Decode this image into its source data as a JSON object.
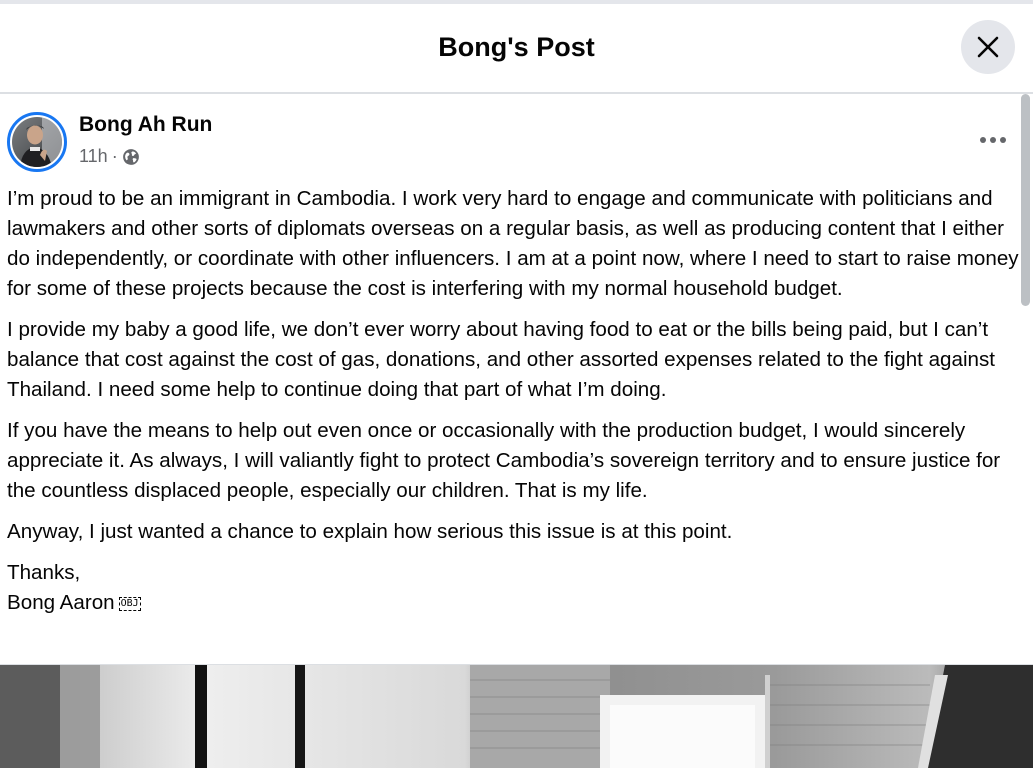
{
  "dialog": {
    "title": "Bong's Post",
    "close_icon": "close-icon"
  },
  "post": {
    "author": "Bong Ah Run",
    "time": "11h",
    "separator": "·",
    "audience_icon": "globe-icon",
    "more_icon": "more-horizontal-icon",
    "paragraphs": [
      "I’m proud to be an immigrant in Cambodia. I work very hard to engage and communicate with politicians and lawmakers and other sorts of diplomats overseas on a regular basis, as well as producing content that I either do independently, or coordinate with other influencers. I am at a point now, where I need to start to raise money for some of these projects because the cost is interfering with my normal household budget.",
      "I provide my baby a good life, we don’t ever worry about having food to eat or the bills being paid, but I can’t balance that cost against the cost of gas, donations, and other assorted expenses related to the fight against Thailand. I need some help to continue doing that part of what I’m doing.",
      "If you have the means to help out even once or occasionally with the production budget, I would sincerely appreciate it. As always, I will valiantly fight to protect Cambodia’s sovereign territory and to ensure justice for the countless displaced people, especially our children. That is my life.",
      "Anyway, I just wanted a chance to explain how serious this issue is at this point."
    ],
    "signoff": "Thanks,",
    "signature": "Bong Aaron",
    "signature_glyph": "OBJ"
  },
  "colors": {
    "accent": "#1877f2",
    "secondary_text": "#65676b",
    "button_bg": "#e4e6eb"
  }
}
